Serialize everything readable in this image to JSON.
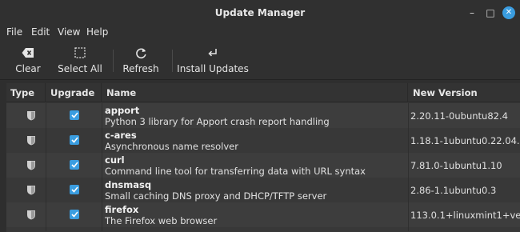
{
  "window": {
    "title": "Update Manager",
    "controls": {
      "minimize": "–",
      "maximize": "□",
      "close": "✕"
    }
  },
  "menu": [
    {
      "label": "File"
    },
    {
      "label": "Edit"
    },
    {
      "label": "View"
    },
    {
      "label": "Help"
    }
  ],
  "toolbar": {
    "clear": {
      "label": "Clear",
      "icon": "backspace-icon"
    },
    "select_all": {
      "label": "Select All",
      "icon": "select-all-icon"
    },
    "refresh": {
      "label": "Refresh",
      "icon": "refresh-icon"
    },
    "install": {
      "label": "Install Updates",
      "icon": "install-icon"
    }
  },
  "table": {
    "headers": {
      "type": "Type",
      "upgrade": "Upgrade",
      "name": "Name",
      "version": "New Version"
    },
    "rows": [
      {
        "name": "apport",
        "desc": "Python 3 library for Apport crash report handling",
        "version": "2.20.11-0ubuntu82.4",
        "checked": true
      },
      {
        "name": "c-ares",
        "desc": "Asynchronous name resolver",
        "version": "1.18.1-1ubuntu0.22.04.1",
        "checked": true
      },
      {
        "name": "curl",
        "desc": "Command line tool for transferring data with URL syntax",
        "version": "7.81.0-1ubuntu1.10",
        "checked": true
      },
      {
        "name": "dnsmasq",
        "desc": "Small caching DNS proxy and DHCP/TFTP server",
        "version": "2.86-1.1ubuntu0.3",
        "checked": true
      },
      {
        "name": "firefox",
        "desc": "The Firefox web browser",
        "version": "113.0.1+linuxmint1+vera",
        "checked": true
      }
    ]
  },
  "colors": {
    "accent": "#3a9de0",
    "window_bg": "#2e2e2e",
    "row_alt": "#3d3d3d"
  }
}
